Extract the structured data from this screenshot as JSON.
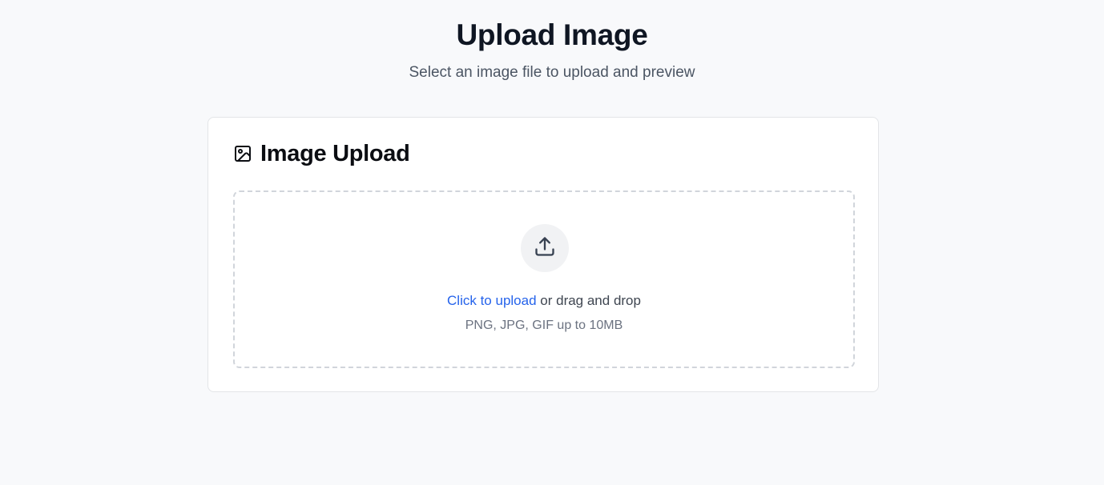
{
  "header": {
    "title": "Upload Image",
    "subtitle": "Select an image file to upload and preview"
  },
  "card": {
    "icon": "image-icon",
    "title": "Image Upload"
  },
  "dropzone": {
    "icon": "upload-icon",
    "link_text": "Click to upload",
    "rest_text": " or drag and drop",
    "hint": "PNG, JPG, GIF up to 10MB"
  },
  "colors": {
    "background": "#f8f9fb",
    "link": "#2563eb",
    "title": "#0f1623",
    "border_dashed": "#d1d5db"
  }
}
